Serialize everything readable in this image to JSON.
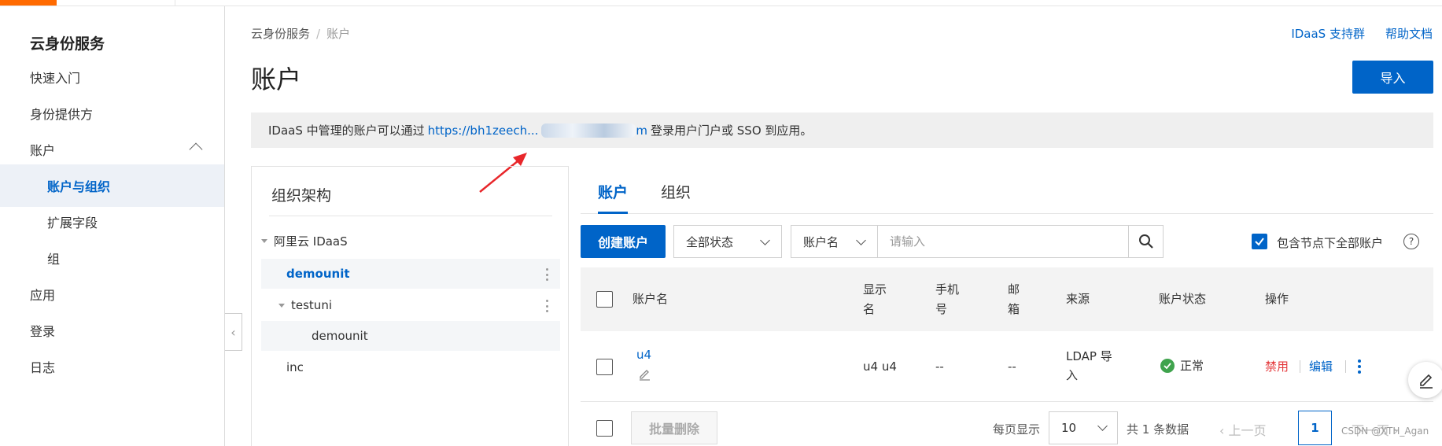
{
  "sidebar": {
    "title": "云身份服务",
    "items": [
      {
        "label": "快速入门"
      },
      {
        "label": "身份提供方"
      },
      {
        "label": "账户"
      },
      {
        "label": "账户与组织"
      },
      {
        "label": "扩展字段"
      },
      {
        "label": "组"
      },
      {
        "label": "应用"
      },
      {
        "label": "登录"
      },
      {
        "label": "日志"
      }
    ]
  },
  "header": {
    "breadcrumb": [
      "云身份服务",
      "账户"
    ],
    "support_link": "IDaaS 支持群",
    "help_link": "帮助文档",
    "title": "账户",
    "import_button": "导入"
  },
  "notice": {
    "prefix": "IDaaS 中管理的账户可以通过",
    "link_start": "https://bh1zeech...",
    "link_end": "m",
    "suffix": "登录用户门户或 SSO 到应用。"
  },
  "org": {
    "heading": "组织架构",
    "tree": [
      {
        "label": "阿里云 IDaaS"
      },
      {
        "label": "demounit"
      },
      {
        "label": "testuni"
      },
      {
        "label": "demounit"
      },
      {
        "label": "inc"
      }
    ]
  },
  "tabs": [
    {
      "label": "账户"
    },
    {
      "label": "组织"
    }
  ],
  "toolbar": {
    "create_button": "创建账户",
    "status_select": "全部状态",
    "field_select": "账户名",
    "search_placeholder": "请输入",
    "include_label": "包含节点下全部账户",
    "help_glyph": "?"
  },
  "table": {
    "headers": {
      "account": "账户名",
      "display": "显示\n名",
      "phone": "手机\n号",
      "email": "邮\n箱",
      "source": "来源",
      "status": "账户状态",
      "ops": "操作"
    },
    "rows": [
      {
        "account": "u4",
        "display": "u4 u4",
        "phone": "--",
        "email": "--",
        "source": "LDAP 导\n入",
        "status": "正常",
        "op_disable": "禁用",
        "op_edit": "编辑"
      }
    ]
  },
  "footer": {
    "batch_delete": "批量删除",
    "per_page_label": "每页显示",
    "per_page_value": "10",
    "total": "共 1 条数据",
    "prev": "上一页",
    "current_page": "1",
    "next": "下一页"
  },
  "watermark": "CSDN @XTH_Agan",
  "colors": {
    "primary": "#0064c8",
    "danger": "#e4393c",
    "success": "#3fa34d",
    "brand": "#ff6a00"
  }
}
